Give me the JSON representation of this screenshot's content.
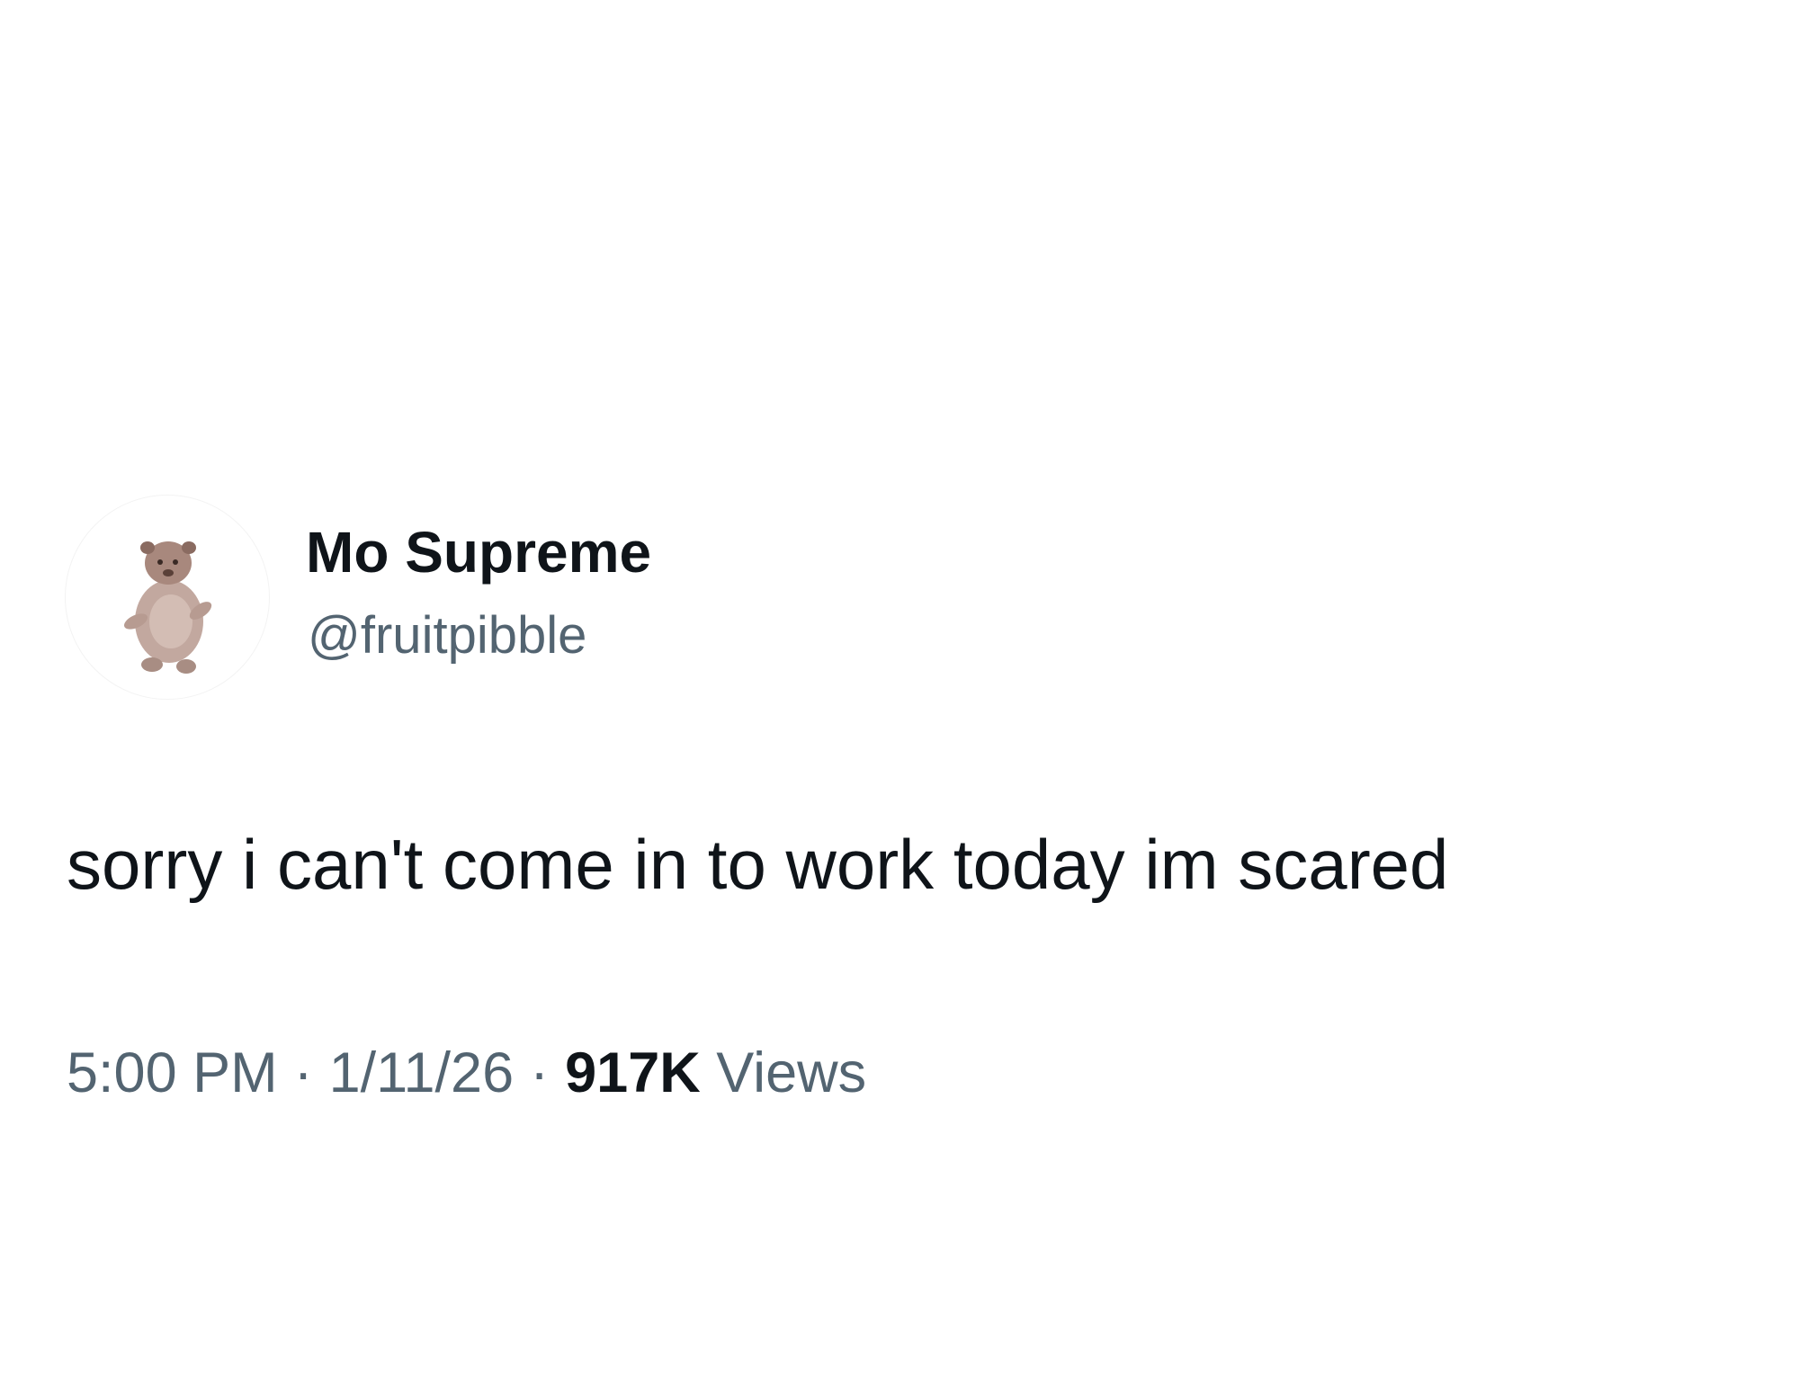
{
  "author": {
    "display_name": "Mo Supreme",
    "handle": "@fruitpibble"
  },
  "tweet": {
    "text": "sorry i can't come in to work today im scared",
    "time": "5:00 PM",
    "date": "1/11/26",
    "views_count": "917K",
    "views_label": "Views",
    "separator": "·"
  },
  "colors": {
    "primary_text": "#0f1419",
    "secondary_text": "#536471",
    "background": "#ffffff"
  },
  "icons": {
    "avatar": "pibble-dog-avatar"
  }
}
